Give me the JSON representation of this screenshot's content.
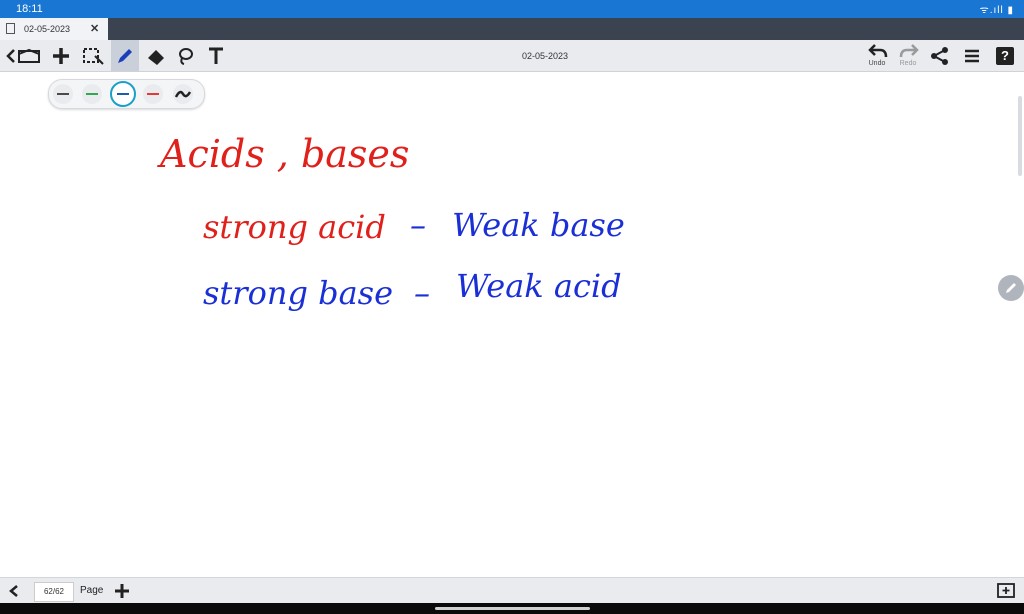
{
  "status_bar": {
    "time": "18:11",
    "system_icons": "ᯤ.ıll ▮"
  },
  "tab": {
    "title": "02-05-2023",
    "close": "✕"
  },
  "toolbar": {
    "document_title": "02-05-2023",
    "undo_label": "Undo",
    "redo_label": "Redo",
    "help_label": "?"
  },
  "palette": {
    "swatches": [
      "#4a4a4a",
      "#2fa84f",
      "#1a5fa8",
      "#e53935"
    ],
    "selected": 2
  },
  "note": {
    "heading": "Acids , bases",
    "line1_left": "strong acid",
    "line1_dash": "–",
    "line1_right": "Weak base",
    "line2_left": "strong base",
    "line2_dash": "–",
    "line2_right": "Weak acid",
    "ink_red": "#e0201b",
    "ink_blue": "#1a2fd6"
  },
  "bottom_bar": {
    "page_counter": "62/62",
    "page_label": "Page",
    "add": "+"
  }
}
